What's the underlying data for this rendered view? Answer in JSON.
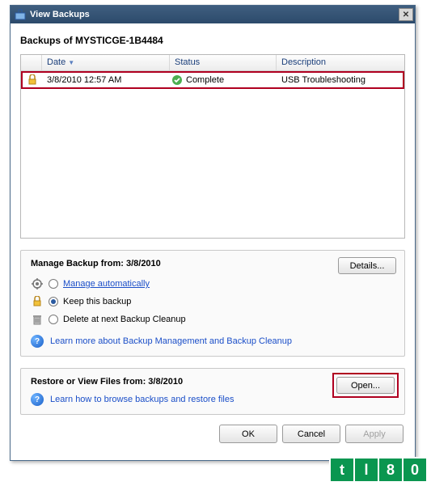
{
  "titlebar": {
    "title": "View Backups"
  },
  "heading": "Backups of MYSTICGE-1B4484",
  "columns": {
    "date": "Date",
    "status": "Status",
    "description": "Description"
  },
  "rows": [
    {
      "date": "3/8/2010 12:57 AM",
      "status": "Complete",
      "description": "USB Troubleshooting"
    }
  ],
  "manage": {
    "title": "Manage Backup from: 3/8/2010",
    "details": "Details...",
    "opt1": "Manage automatically",
    "opt2": "Keep this backup",
    "opt3": "Delete at next Backup Cleanup",
    "help": "Learn more about Backup Management and Backup Cleanup"
  },
  "restore": {
    "title": "Restore or View Files from: 3/8/2010",
    "open": "Open...",
    "help": "Learn how to browse backups and restore files"
  },
  "buttons": {
    "ok": "OK",
    "cancel": "Cancel",
    "apply": "Apply"
  },
  "watermark": "tl80"
}
